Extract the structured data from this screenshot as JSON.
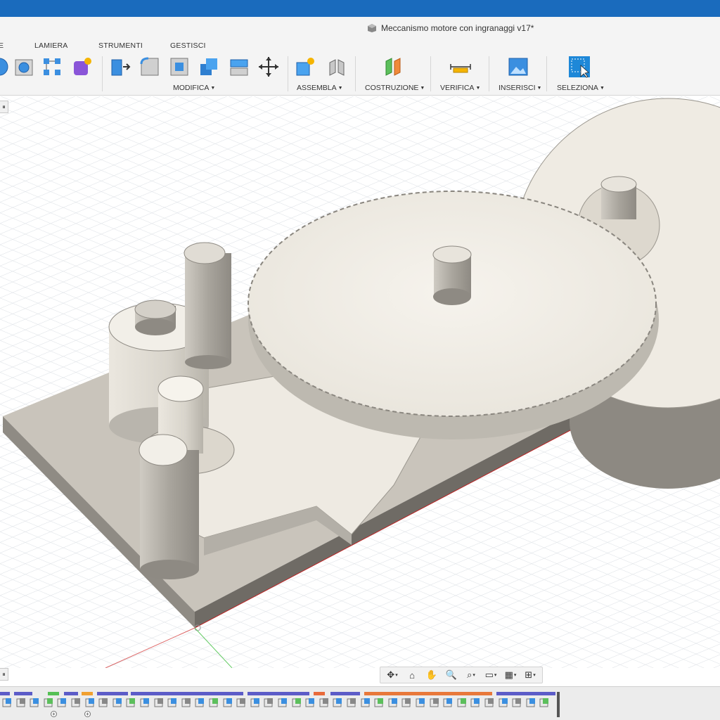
{
  "window": {
    "title": "Meccanismo motore con ingranaggi v17*"
  },
  "tabs": [
    {
      "label": "E"
    },
    {
      "label": "LAMIERA"
    },
    {
      "label": "STRUMENTI"
    },
    {
      "label": "GESTISCI"
    }
  ],
  "groups": {
    "modifica": "MODIFICA",
    "assembla": "ASSEMBLA",
    "costruzione": "COSTRUZIONE",
    "verifica": "VERIFICA",
    "inserisci": "INSERISCI",
    "seleziona": "SELEZIONA"
  },
  "colors": {
    "titlebar": "#1a6bbd",
    "accent_blue": "#2f8fe0",
    "model_face": "#f0ede6",
    "model_side": "#b5b1a8",
    "grid": "#d9dde3"
  },
  "left_stubs": {
    "top": "⏸",
    "bottom": "⏸"
  },
  "nav_icons": [
    "orbit-icon",
    "look-at-icon",
    "pan-icon",
    "zoom-icon",
    "fit-icon",
    "display-icon",
    "grid-icon",
    "viewport-icon"
  ]
}
